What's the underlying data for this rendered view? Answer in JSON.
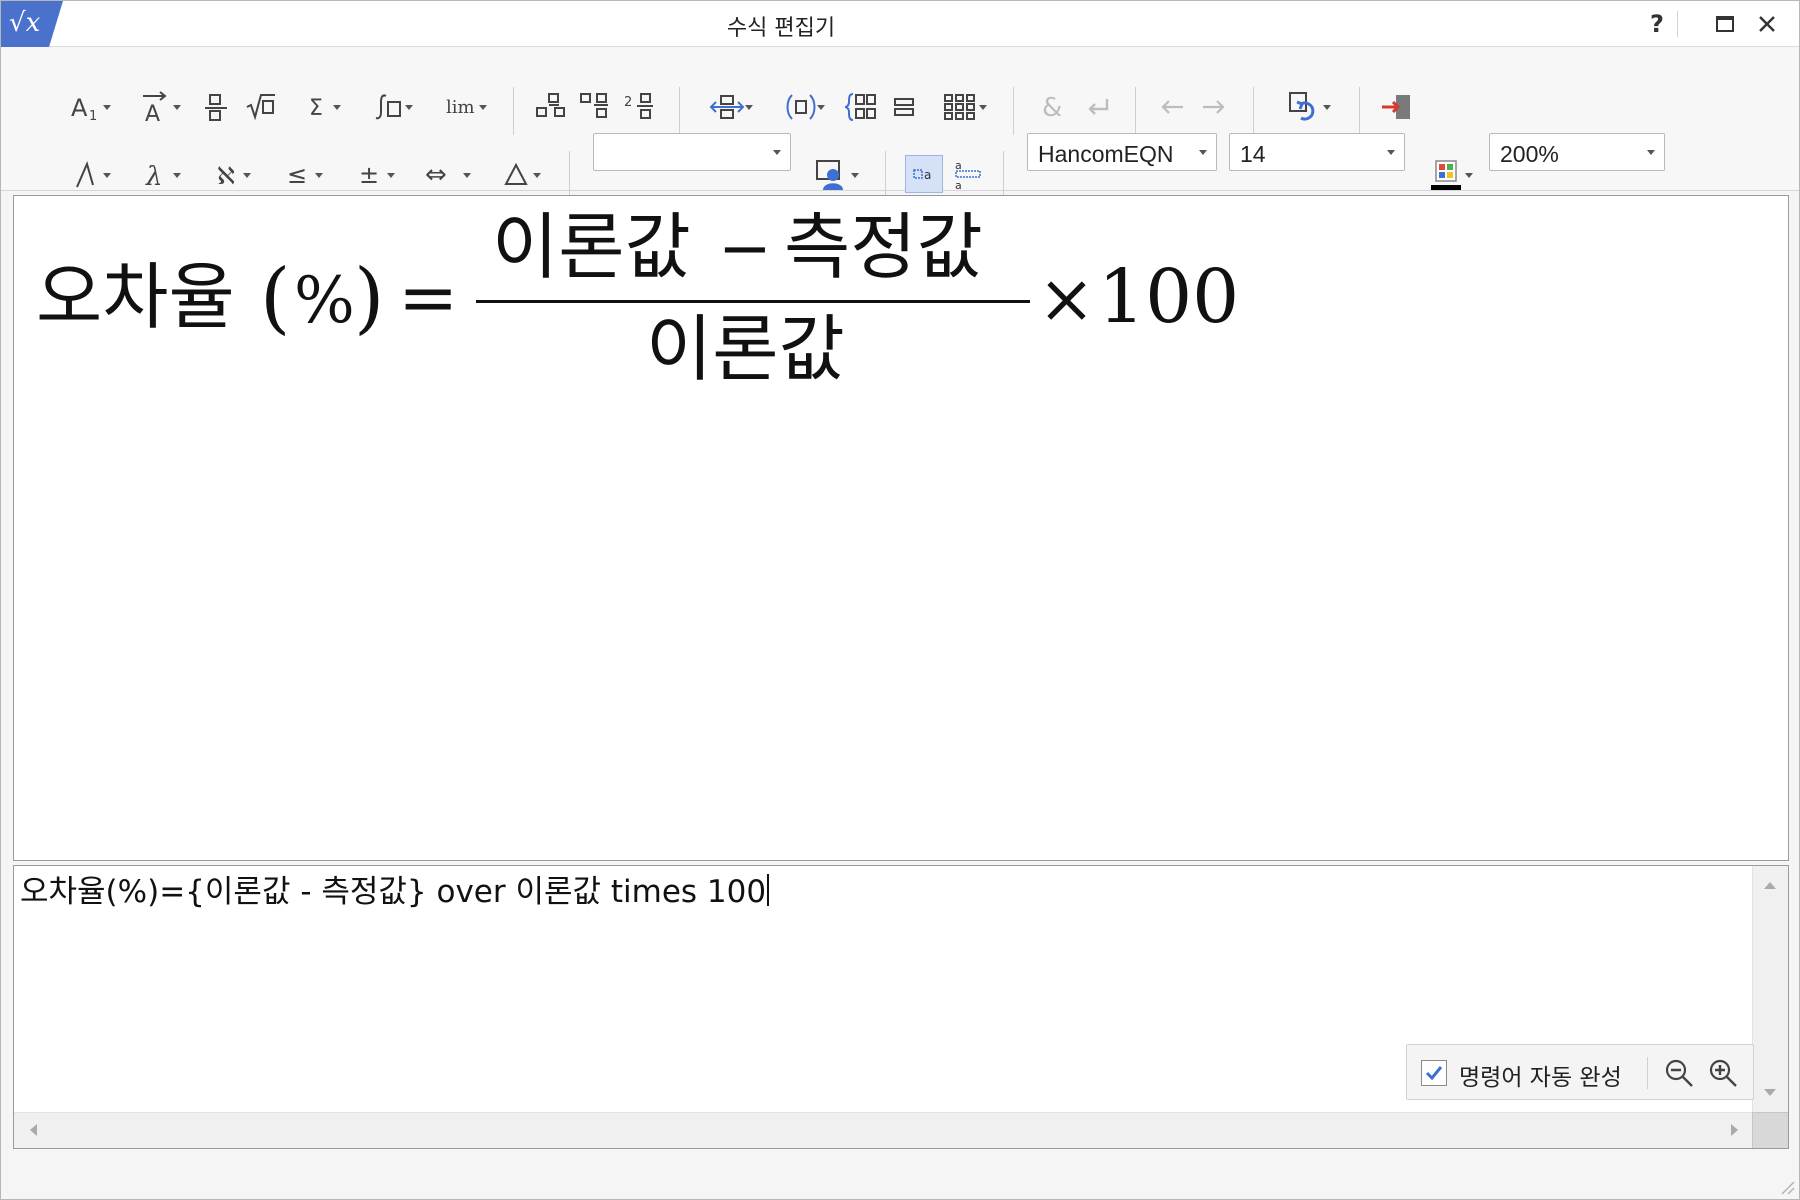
{
  "window": {
    "title": "수식 편집기"
  },
  "titlebar": {
    "help_label": "?"
  },
  "format": {
    "style_value": "",
    "font_value": "HancomEQN",
    "size_value": "14",
    "zoom_value": "200%"
  },
  "equation": {
    "lhs": "오차율",
    "paren_open": "(",
    "percent": "%",
    "paren_close": ")",
    "equals": "=",
    "numerator_left": "이론값",
    "minus": "−",
    "numerator_right": "측정값",
    "denominator": "이론값",
    "times": "×",
    "multiplier": "100"
  },
  "editor": {
    "script": "오차율(%)={이론값 - 측정값} over 이론값 times 100",
    "autocomplete_label": "명령어 자동 완성",
    "autocomplete_checked": true
  },
  "colors": {
    "accent": "#3f6fd0",
    "exit_red": "#d23a2f"
  }
}
